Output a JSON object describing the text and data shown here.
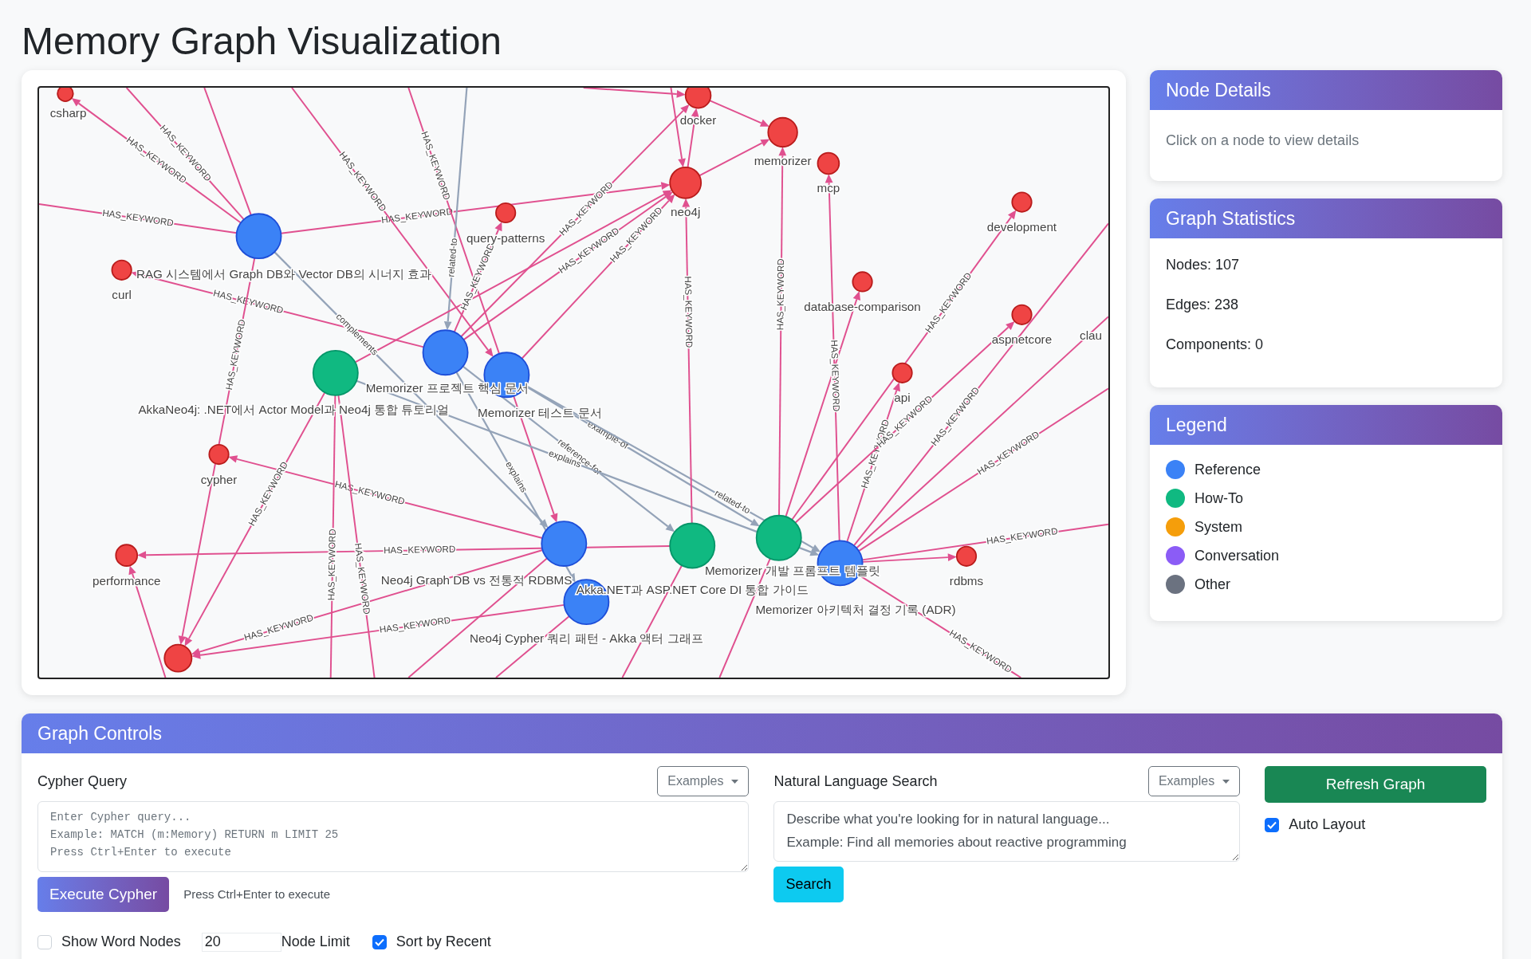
{
  "title": "Memory Graph Visualization",
  "graph": {
    "nodes": [
      {
        "label": "csharp",
        "kind": "keyword"
      },
      {
        "label": "docker",
        "kind": "keyword"
      },
      {
        "label": "memorizer",
        "kind": "keyword"
      },
      {
        "label": "mcp",
        "kind": "keyword"
      },
      {
        "label": "neo4j",
        "kind": "keyword"
      },
      {
        "label": "query-patterns",
        "kind": "keyword"
      },
      {
        "label": "development",
        "kind": "keyword"
      },
      {
        "label": "curl",
        "kind": "keyword"
      },
      {
        "label": "database-comparison",
        "kind": "keyword"
      },
      {
        "label": "aspnetcore",
        "kind": "keyword"
      },
      {
        "label": "clau",
        "kind": "keyword"
      },
      {
        "label": "api",
        "kind": "keyword"
      },
      {
        "label": "cypher",
        "kind": "keyword"
      },
      {
        "label": "performance",
        "kind": "keyword"
      },
      {
        "kind": "keyword"
      },
      {
        "label": "rdbms",
        "kind": "keyword"
      },
      {
        "label": "RAG 시스템에서 Graph DB와 Vector DB의 시너지 효과",
        "kind": "reference"
      },
      {
        "label": "AkkaNeo4j: .NET에서 Actor Model과 Neo4j 통합 튜토리얼",
        "kind": "how-to"
      },
      {
        "label": "Memorizer 프로젝트 핵심 문서",
        "kind": "reference"
      },
      {
        "label": "Memorizer 테스트 문서",
        "kind": "reference"
      },
      {
        "label": "Neo4j Graph DB vs 전통적 RDBMS",
        "kind": "reference"
      },
      {
        "label": "Neo4j Cypher 쿼리 패턴 - Akka 액터 그래프",
        "kind": "reference"
      },
      {
        "label": "Akka.NET과 ASP.NET Core DI 통합 가이드",
        "kind": "how-to"
      },
      {
        "label": "Memorizer 개발 프롬프트 템플릿",
        "kind": "how-to"
      },
      {
        "label": "Memorizer 아키텍처 결정 기록 (ADR)",
        "kind": "reference"
      }
    ],
    "edges": [
      {
        "kind": "keyword",
        "label": "HAS_KEYWORD"
      },
      {
        "kind": "keyword",
        "label": "HAS_KEYWORD"
      },
      {
        "kind": "keyword",
        "label": "HAS_KEYWORD"
      },
      {
        "kind": "keyword"
      },
      {
        "kind": "keyword",
        "label": "HAS_KEYWORD"
      },
      {
        "kind": "keyword",
        "label": "HAS_KEYWORD"
      },
      {
        "kind": "keyword",
        "label": "HAS_KEYWORD"
      },
      {
        "kind": "keyword",
        "label": "HAS_KEYWORD"
      },
      {
        "kind": "keyword",
        "label": "HAS_KEYWORD"
      },
      {
        "kind": "relation",
        "label": "related-to"
      },
      {
        "kind": "keyword"
      },
      {
        "kind": "keyword",
        "label": "HAS_KEYWORD"
      },
      {
        "kind": "keyword",
        "label": "HAS_KEYWORD"
      },
      {
        "kind": "keyword",
        "label": "HAS_KEYWORD"
      },
      {
        "kind": "relation",
        "label": "complements"
      },
      {
        "kind": "relation",
        "label": "explains"
      },
      {
        "kind": "relation",
        "label": "reference-for"
      },
      {
        "kind": "relation",
        "label": "example-of"
      },
      {
        "kind": "relation",
        "label": "explains"
      },
      {
        "kind": "relation",
        "label": "related-to"
      },
      {
        "kind": "keyword",
        "label": "HAS_KEYWORD"
      },
      {
        "kind": "keyword",
        "label": "HAS_KEYWORD"
      },
      {
        "kind": "keyword",
        "label": "HAS_KEYWORD"
      },
      {
        "kind": "keyword",
        "label": "HAS_KEYWORD"
      },
      {
        "kind": "keyword",
        "label": "HAS_KEYWORD"
      },
      {
        "kind": "keyword",
        "label": "HAS_KEYWORD"
      },
      {
        "kind": "keyword",
        "label": "HAS_KEYWORD"
      },
      {
        "kind": "keyword",
        "label": "HAS_KEYWORD"
      },
      {
        "kind": "keyword"
      },
      {
        "kind": "keyword",
        "label": "HAS_KEYWORD"
      },
      {
        "kind": "keyword",
        "label": "HAS_KEYWORD"
      },
      {
        "kind": "keyword",
        "label": "HAS_KEYWORD"
      },
      {
        "kind": "keyword"
      },
      {
        "kind": "keyword",
        "label": "HAS_KEYWORD"
      },
      {
        "kind": "keyword",
        "label": "HAS_KEYWORD"
      },
      {
        "kind": "keyword",
        "label": "HAS_KEYWORD"
      },
      {
        "kind": "keyword",
        "label": "HAS_KEYWORD"
      },
      {
        "kind": "keyword",
        "label": "HAS_KEYWORD"
      },
      {
        "kind": "keyword",
        "label": "HAS_KEYWORD"
      },
      {
        "kind": "keyword"
      },
      {
        "kind": "keyword"
      },
      {
        "kind": "keyword"
      },
      {
        "kind": "keyword"
      },
      {
        "kind": "keyword",
        "label": "HAS_KEYWORD"
      },
      {
        "kind": "keyword"
      },
      {
        "kind": "keyword"
      },
      {
        "kind": "keyword"
      },
      {
        "kind": "keyword"
      },
      {
        "kind": "keyword"
      },
      {
        "kind": "keyword"
      },
      {
        "kind": "keyword"
      }
    ]
  },
  "node_details": {
    "title": "Node Details",
    "hint": "Click on a node to view details"
  },
  "statistics": {
    "title": "Graph Statistics",
    "items": [
      "Nodes: 107",
      "Edges: 238",
      "Components: 0"
    ]
  },
  "legend": {
    "title": "Legend",
    "items": [
      {
        "label": "Reference",
        "color": "#3b82f6"
      },
      {
        "label": "How-To",
        "color": "#10b981"
      },
      {
        "label": "System",
        "color": "#f59e0b"
      },
      {
        "label": "Conversation",
        "color": "#8b5cf6"
      },
      {
        "label": "Other",
        "color": "#6b7280"
      }
    ]
  },
  "controls": {
    "title": "Graph Controls",
    "cypher": {
      "label": "Cypher Query",
      "examples": "Examples",
      "placeholder": "Enter Cypher query...\nExample: MATCH (m:Memory) RETURN m LIMIT 25\nPress Ctrl+Enter to execute",
      "button": "Execute Cypher",
      "hint": "Press Ctrl+Enter to execute"
    },
    "options": {
      "show_word_nodes": {
        "label": "Show Word Nodes",
        "checked": false
      },
      "node_limit": {
        "value": "20",
        "label": "Node Limit"
      },
      "sort_by_recent": {
        "label": "Sort by Recent",
        "checked": true
      }
    },
    "natural": {
      "label": "Natural Language Search",
      "examples": "Examples",
      "placeholder": "Describe what you're looking for in natural language...\nExample: Find all memories about reactive programming",
      "button": "Search"
    },
    "refresh": {
      "button": "Refresh Graph",
      "auto_layout": {
        "label": "Auto Layout",
        "checked": true
      }
    }
  }
}
